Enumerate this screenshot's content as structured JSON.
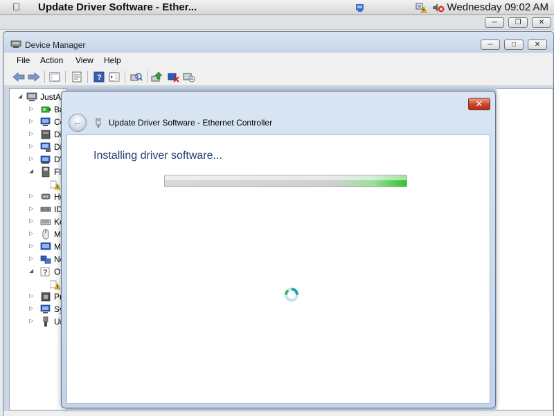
{
  "mac_menubar": {
    "app_title": "Update Driver Software - Ether...",
    "clock": "Wednesday 09:02 AM",
    "icons": [
      "apple-icon",
      "vm-app-icon",
      "network-warning-icon",
      "volume-muted-icon"
    ]
  },
  "vm_window": {
    "controls": [
      "minimize",
      "restore",
      "close"
    ]
  },
  "device_manager": {
    "title": "Device Manager",
    "menu": [
      "File",
      "Action",
      "View",
      "Help"
    ],
    "toolbar": [
      "back",
      "forward",
      "show-hide-console-tree",
      "properties",
      "help",
      "action-pane",
      "scan-for-hardware-changes",
      "update-driver",
      "uninstall",
      "disable"
    ],
    "tree": {
      "root": "JustAl",
      "items": [
        {
          "label": "Ba",
          "icon": "battery-icon"
        },
        {
          "label": "Co",
          "icon": "computer-icon"
        },
        {
          "label": "Di",
          "icon": "disk-drive-icon"
        },
        {
          "label": "Di",
          "icon": "display-adapter-icon"
        },
        {
          "label": "DV",
          "icon": "dvd-drive-icon"
        },
        {
          "label": "Fl",
          "icon": "floppy-icon",
          "expanded": true
        },
        {
          "label": "",
          "icon": "warning-device-icon",
          "child": true
        },
        {
          "label": "Hu",
          "icon": "hid-icon"
        },
        {
          "label": "ID",
          "icon": "ide-controller-icon"
        },
        {
          "label": "Ke",
          "icon": "keyboard-icon"
        },
        {
          "label": "Mi",
          "icon": "mouse-icon"
        },
        {
          "label": "Mo",
          "icon": "monitor-icon"
        },
        {
          "label": "Ne",
          "icon": "network-adapter-icon"
        },
        {
          "label": "Ot",
          "icon": "other-devices-icon",
          "expanded": true
        },
        {
          "label": "",
          "icon": "warning-device-icon",
          "child": true
        },
        {
          "label": "Pr",
          "icon": "processor-icon"
        },
        {
          "label": "Sy",
          "icon": "system-devices-icon"
        },
        {
          "label": "Ur",
          "icon": "usb-icon"
        }
      ]
    }
  },
  "dialog": {
    "title": "Update Driver Software - Ethernet Controller",
    "close_label": "✕",
    "back_label": "←",
    "heading": "Installing driver software...",
    "progress": {
      "state": "indeterminate",
      "accent": "#2cc32c"
    }
  }
}
